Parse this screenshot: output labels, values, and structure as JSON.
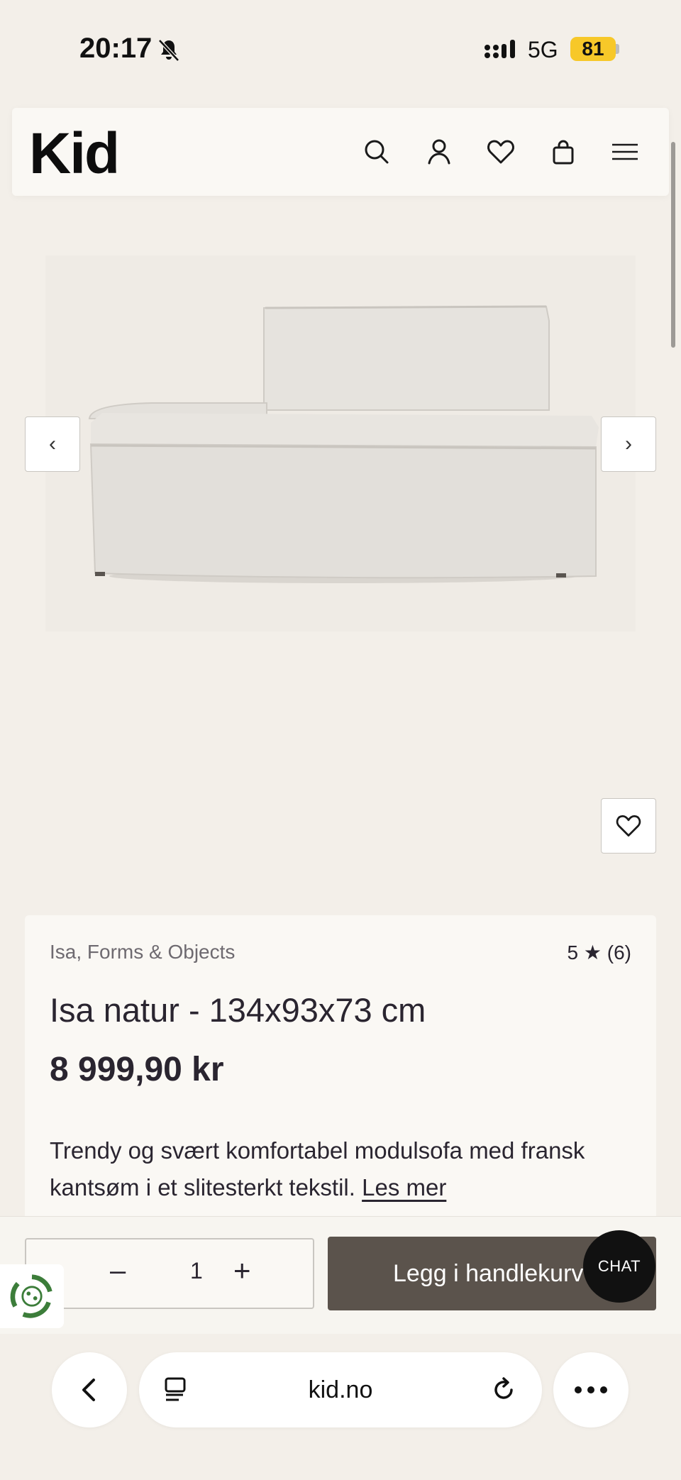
{
  "status_bar": {
    "time": "20:17",
    "network": "5G",
    "battery": "81"
  },
  "header": {
    "logo": "Kid",
    "icons": [
      "search-icon",
      "account-icon",
      "wishlist-icon",
      "cart-icon",
      "menu-icon"
    ]
  },
  "carousel": {
    "prev_label": "‹",
    "next_label": "›"
  },
  "product": {
    "brand": "Isa, Forms & Objects",
    "rating": "5 ★ (6)",
    "name": "Isa natur - 134x93x73 cm",
    "price": "8 999,90 kr",
    "description": "Trendy og svært komfortabel modulsofa med fransk kantsøm i et slitesterkt tekstil.",
    "read_more": "Les mer"
  },
  "purchase": {
    "qty_minus": "–",
    "quantity": "1",
    "qty_plus": "+",
    "add_to_cart": "Legg i handlekurv",
    "chat": "CHAT"
  },
  "browser": {
    "url": "kid.no"
  },
  "colors": {
    "background": "#f3efe9",
    "card": "#faf8f4",
    "button_dark": "#5b534c",
    "battery": "#f7c829",
    "eco_green": "#3c7d3a"
  }
}
